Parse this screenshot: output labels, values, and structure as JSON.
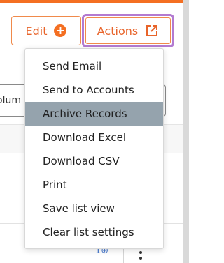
{
  "toolbar": {
    "edit_label": "Edit",
    "actions_label": "Actions"
  },
  "background": {
    "field_text": "olum",
    "link_text": "1⊕"
  },
  "menu": {
    "items": [
      {
        "label": "Send Email"
      },
      {
        "label": "Send to Accounts"
      },
      {
        "label": "Archive Records"
      },
      {
        "label": "Download Excel"
      },
      {
        "label": "Download CSV"
      },
      {
        "label": "Print"
      },
      {
        "label": "Save list view"
      },
      {
        "label": "Clear list settings"
      }
    ],
    "highlighted": "Archive Records"
  },
  "colors": {
    "accent": "#f46f22",
    "focus_ring": "#b37ad0",
    "highlight": "#95a3ad"
  }
}
